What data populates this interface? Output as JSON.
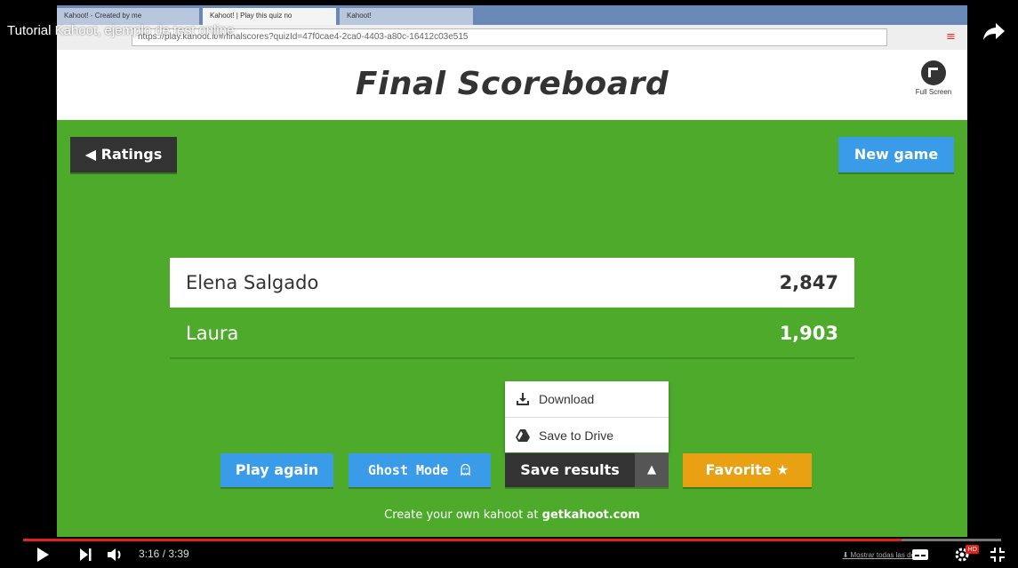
{
  "video": {
    "title": "Tutorial Kahoot, ejemplo de test online",
    "time": "3:16 / 3:39",
    "progress_fraction": 0.898,
    "taskbar_link": "Mostrar todas las des"
  },
  "browser": {
    "tabs": [
      {
        "label": "Kahoot! - Created by me"
      },
      {
        "label": "Kahoot! | Play this quiz no"
      },
      {
        "label": "Kahoot!"
      }
    ],
    "url": "https://play.kahoot.it/#/finalscores?quizId=47f0cae4-2ca0-4403-a80c-16412c03e515"
  },
  "kahoot": {
    "title": "Final Scoreboard",
    "fullscreen_label": "Full Screen",
    "ratings_label": "◀ Ratings",
    "new_game_label": "New game",
    "scores": [
      {
        "name": "Elena Salgado",
        "score": "2,847"
      },
      {
        "name": "Laura",
        "score": "1,903"
      }
    ],
    "dropdown": {
      "download_label": "Download",
      "drive_label": "Save to Drive"
    },
    "buttons": {
      "play_again": "Play again",
      "ghost_mode": "Ghost Mode",
      "save_results": "Save results",
      "save_arrow": "▲",
      "favorite": "Favorite ★"
    },
    "footer": {
      "text": "Create your own kahoot at ",
      "link": "getkahoot.com"
    }
  },
  "colors": {
    "kahoot_green": "#4daa2b",
    "blue_button": "#3a9be8",
    "dark_button": "#333333",
    "orange_button": "#eaa013",
    "progress_red": "#e62117"
  }
}
